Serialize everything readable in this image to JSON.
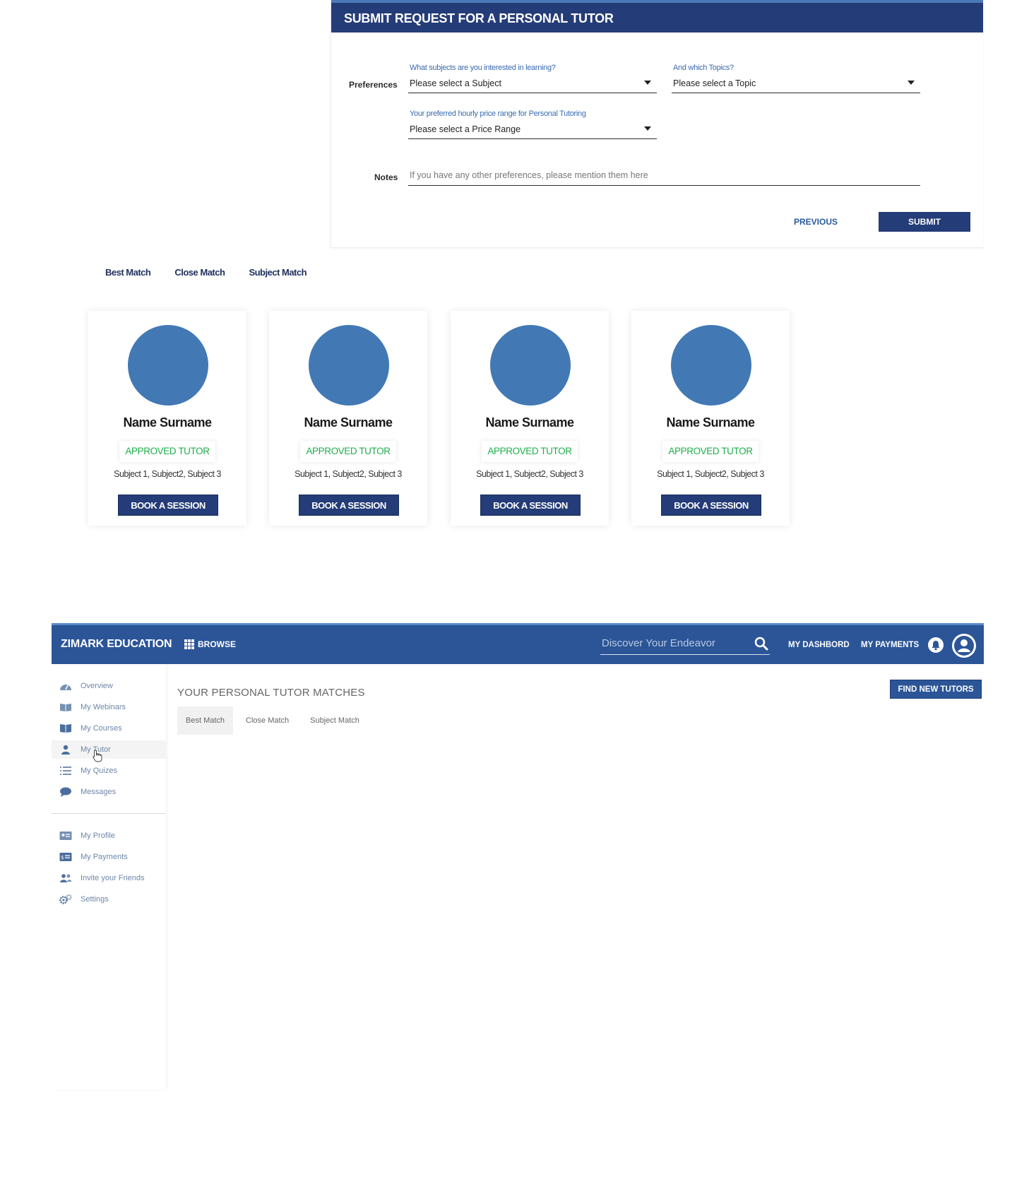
{
  "request_form": {
    "title": "SUBMIT REQUEST FOR A PERSONAL TUTOR",
    "preferences_label": "Preferences",
    "subject_question": "What subjects are you interested in learning?",
    "subject_value": "Please select a Subject",
    "topic_question": "And which Topics?",
    "topic_value": "Please select a Topic",
    "price_question": "Your preferred hourly price range for Personal Tutoring",
    "price_value": "Please select a Price Range",
    "notes_label": "Notes",
    "notes_placeholder": "If you have any other preferences, please mention them here",
    "previous_label": "PREVIOUS",
    "submit_label": "SUBMIT"
  },
  "match_tabs": [
    "Best Match",
    "Close Match",
    "Subject Match"
  ],
  "tutors": [
    {
      "name": "Name Surname",
      "status": "APPROVED TUTOR",
      "subjects": "Subject 1, Subject2, Subject 3",
      "book_label": "BOOK A SESSION"
    },
    {
      "name": "Name Surname",
      "status": "APPROVED TUTOR",
      "subjects": "Subject 1, Subject2, Subject 3",
      "book_label": "BOOK A SESSION"
    },
    {
      "name": "Name Surname",
      "status": "APPROVED TUTOR",
      "subjects": "Subject 1, Subject2, Subject 3",
      "book_label": "BOOK A SESSION"
    },
    {
      "name": "Name Surname",
      "status": "APPROVED TUTOR",
      "subjects": "Subject 1, Subject2, Subject 3",
      "book_label": "BOOK A SESSION"
    }
  ],
  "dashboard": {
    "brand": "ZIMARK EDUCATION",
    "browse_label": "BROWSE",
    "search_placeholder": "Discover Your Endeavor",
    "nav_dashboard": "MY DASHBORD",
    "nav_payments": "MY PAYMENTS",
    "sidebar_primary": [
      {
        "label": "Overview",
        "icon": "gauge-icon"
      },
      {
        "label": "My Webinars",
        "icon": "book-open-icon"
      },
      {
        "label": "My Courses",
        "icon": "book-icon"
      },
      {
        "label": "My Tutor",
        "icon": "tutor-icon"
      },
      {
        "label": "My Quizes",
        "icon": "list-icon"
      },
      {
        "label": "Messages",
        "icon": "chat-icon"
      }
    ],
    "sidebar_secondary": [
      {
        "label": "My Profile",
        "icon": "id-card-icon"
      },
      {
        "label": "My Payments",
        "icon": "payment-card-icon"
      },
      {
        "label": "Invite your Friends",
        "icon": "users-icon"
      },
      {
        "label": "Settings",
        "icon": "gears-icon"
      }
    ],
    "title": "YOUR PERSONAL TUTOR MATCHES",
    "find_button": "FIND NEW TUTORS",
    "tabs": [
      "Best Match",
      "Close Match",
      "Subject Match"
    ]
  },
  "colors": {
    "navy": "#243c77",
    "nav_blue": "#2b5597",
    "avatar_blue": "#4279b5",
    "approved_green": "#1fae4b",
    "link_blue": "#3a6bb0"
  }
}
